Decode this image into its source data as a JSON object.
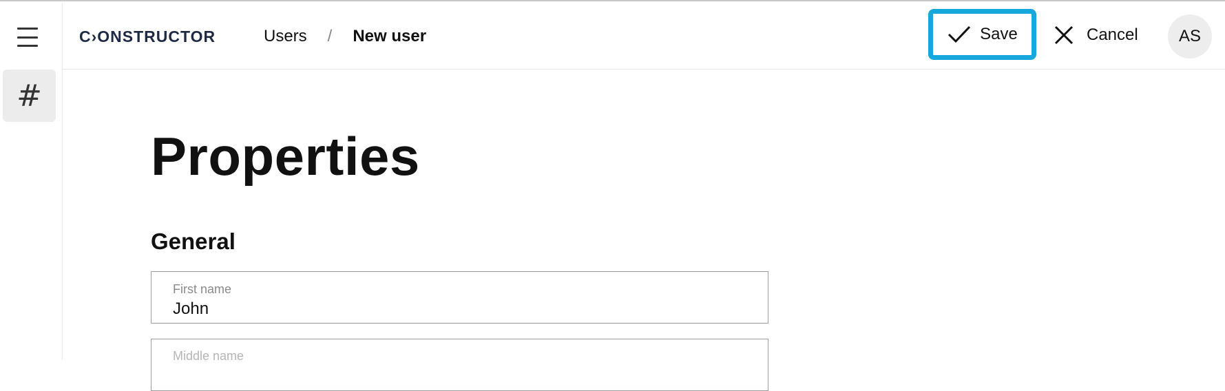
{
  "app": {
    "logo_text": "C›ONSTRUCTOR"
  },
  "rail": {
    "menu_icon": "hamburger-menu-icon",
    "hash_label": "#"
  },
  "breadcrumb": {
    "parent": "Users",
    "separator": "/",
    "current": "New user"
  },
  "toolbar": {
    "save_label": "Save",
    "save_icon": "checkmark-icon",
    "cancel_label": "Cancel",
    "cancel_icon": "close-icon",
    "avatar_initials": "AS"
  },
  "form": {
    "title": "Properties",
    "section": "General",
    "fields": [
      {
        "label": "First name",
        "value": "John"
      },
      {
        "label": "Middle name",
        "value": ""
      }
    ]
  },
  "colors": {
    "focus_ring": "#16a7dd",
    "logo": "#1e2a44",
    "active_rail": "#ececec"
  }
}
